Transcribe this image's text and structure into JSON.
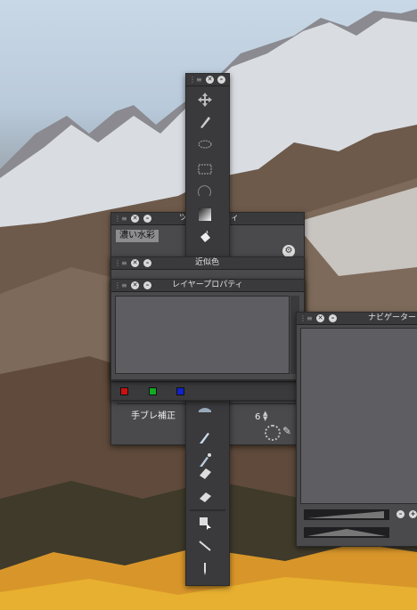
{
  "desktop": {
    "sky_color": "#c4d4e4",
    "mountain_color": "#7a6a5e",
    "foliage_color": "#e0a020"
  },
  "windows": {
    "tool_property": {
      "title": "ツ",
      "title_tail": "ィ",
      "brush_label": "濃い水彩",
      "stabilizer_label": "手ブレ補正",
      "stabilizer_value": "6"
    },
    "approx_color": {
      "title": "近似色",
      "swatch_colors": [
        "#cc1111",
        "#11aa22",
        "#1122cc"
      ]
    },
    "layer_property": {
      "title": "レイヤープロパティ"
    },
    "navigator": {
      "title": "ナビゲーター"
    }
  },
  "toolbox": {
    "tools": [
      "move-icon",
      "pen-tool-icon",
      "lasso-icon",
      "marquee-icon",
      "magic-wand-icon",
      "gradient-icon",
      "fill-bucket-icon",
      "airbrush-icon",
      "watercolor-icon",
      "oil-brush-icon",
      "eraser-icon",
      "blend-eraser-icon",
      "object-select-icon",
      "line-tool-icon",
      "eyedropper-icon"
    ]
  }
}
